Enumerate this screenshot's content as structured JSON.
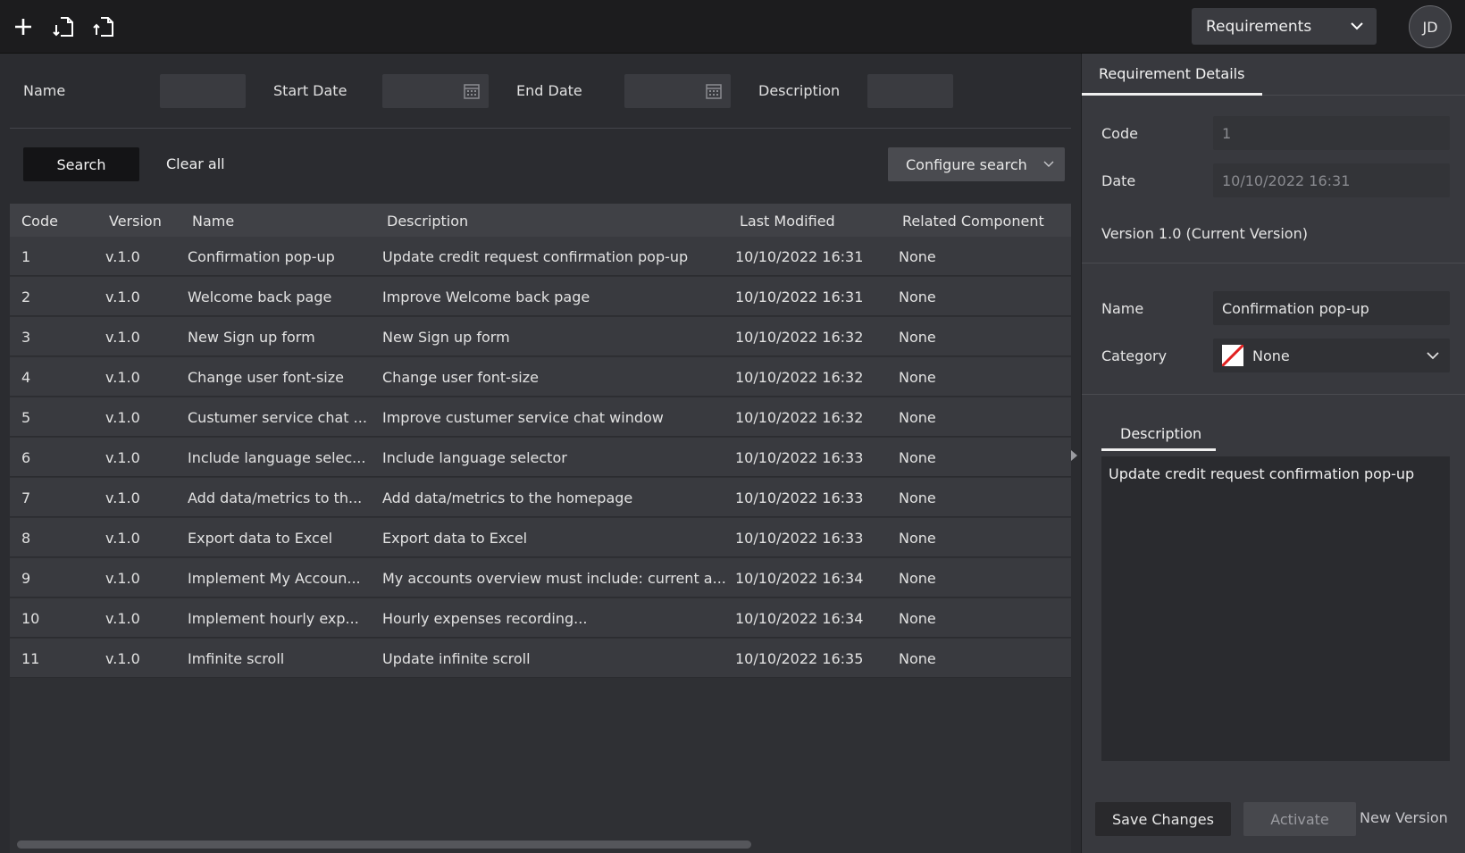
{
  "toolbar": {
    "icons": [
      "plus-icon",
      "import-file-icon",
      "export-file-icon"
    ],
    "module_select": "Requirements",
    "avatar_initials": "JD"
  },
  "filters": {
    "name_label": "Name",
    "start_date_label": "Start Date",
    "end_date_label": "End Date",
    "description_label": "Description"
  },
  "actions": {
    "search": "Search",
    "clear_all": "Clear all",
    "configure_search": "Configure search"
  },
  "table": {
    "columns": [
      "Code",
      "Version",
      "Name",
      "Description",
      "Last Modified",
      "Related Component"
    ],
    "rows": [
      {
        "code": "1",
        "version": "v.1.0",
        "name": "Confirmation pop-up",
        "description": "Update credit request confirmation pop-up",
        "modified": "10/10/2022 16:31",
        "related": "None"
      },
      {
        "code": "2",
        "version": "v.1.0",
        "name": "Welcome back page",
        "description": "Improve Welcome back page",
        "modified": "10/10/2022 16:31",
        "related": "None"
      },
      {
        "code": "3",
        "version": "v.1.0",
        "name": "New Sign up form",
        "description": "New Sign up form",
        "modified": "10/10/2022 16:32",
        "related": "None"
      },
      {
        "code": "4",
        "version": "v.1.0",
        "name": "Change user font-size",
        "description": "Change user font-size",
        "modified": "10/10/2022 16:32",
        "related": "None"
      },
      {
        "code": "5",
        "version": "v.1.0",
        "name": "Custumer service chat ...",
        "description": "Improve custumer service chat window",
        "modified": "10/10/2022 16:32",
        "related": "None"
      },
      {
        "code": "6",
        "version": "v.1.0",
        "name": "Include language selec...",
        "description": "Include language selector",
        "modified": "10/10/2022 16:33",
        "related": "None"
      },
      {
        "code": "7",
        "version": "v.1.0",
        "name": "Add data/metrics to th...",
        "description": "Add data/metrics to the homepage",
        "modified": "10/10/2022 16:33",
        "related": "None"
      },
      {
        "code": "8",
        "version": "v.1.0",
        "name": "Export data to Excel",
        "description": "Export data to Excel",
        "modified": "10/10/2022 16:33",
        "related": "None"
      },
      {
        "code": "9",
        "version": "v.1.0",
        "name": "Implement My Accoun...",
        "description": "My accounts overview must include: current a...",
        "modified": "10/10/2022 16:34",
        "related": "None"
      },
      {
        "code": "10",
        "version": "v.1.0",
        "name": "Implement hourly exp...",
        "description": "Hourly expenses recording...",
        "modified": "10/10/2022 16:34",
        "related": "None"
      },
      {
        "code": "11",
        "version": "v.1.0",
        "name": "Imfinite scroll",
        "description": "Update infinite scroll",
        "modified": "10/10/2022 16:35",
        "related": "None"
      }
    ]
  },
  "details": {
    "tab": "Requirement Details",
    "code_label": "Code",
    "code_value": "1",
    "date_label": "Date",
    "date_value": "10/10/2022 16:31",
    "version_text": "Version 1.0 (Current Version)",
    "name_label": "Name",
    "name_value": "Confirmation pop-up",
    "category_label": "Category",
    "category_value": "None",
    "description_tab": "Description",
    "description_value": "Update credit request confirmation pop-up",
    "save": "Save Changes",
    "activate": "Activate",
    "new_version": "New Version"
  }
}
